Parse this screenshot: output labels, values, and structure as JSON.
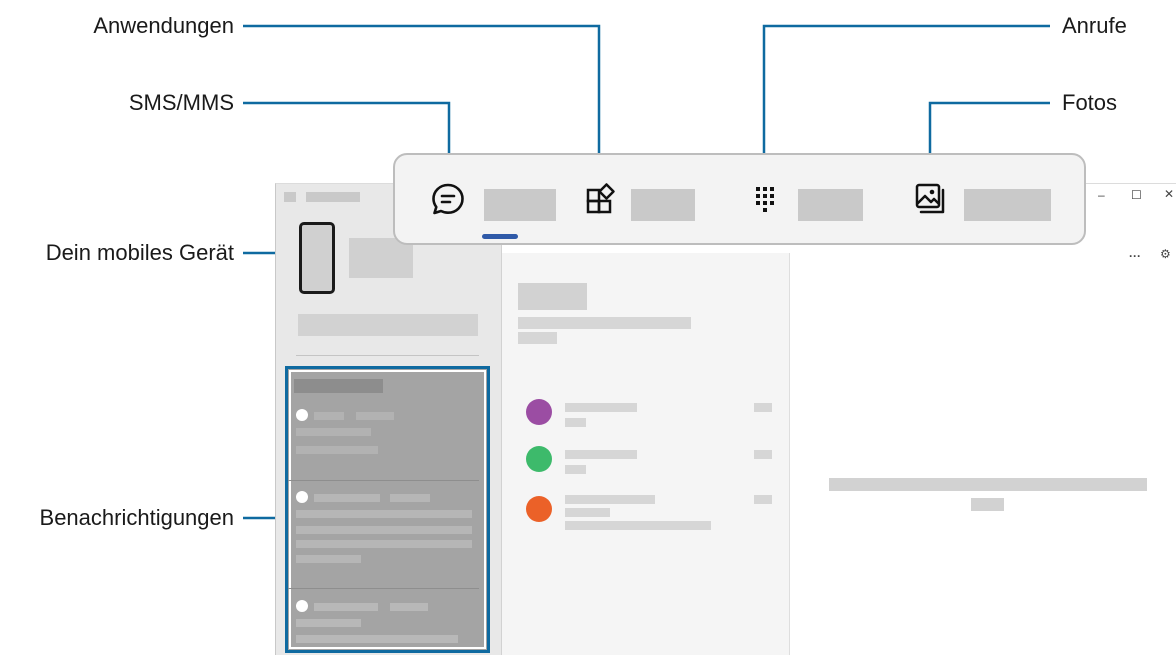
{
  "callouts": {
    "anwendungen": "Anwendungen",
    "sms_mms": "SMS/MMS",
    "device": "Dein mobiles Gerät",
    "notifications": "Benachrichtigungen",
    "calls": "Anrufe",
    "photos": "Fotos"
  },
  "window_controls": {
    "minimize": "–",
    "maximize": "☐",
    "close": "✕",
    "more": "···",
    "settings": "⚙"
  },
  "tabs": [
    {
      "icon": "message-bubble-icon",
      "active": true
    },
    {
      "icon": "apps-grid-icon",
      "active": false
    },
    {
      "icon": "dialpad-icon",
      "active": false
    },
    {
      "icon": "photos-gallery-icon",
      "active": false
    }
  ],
  "contacts": [
    {
      "avatar_color": "#9b4da3"
    },
    {
      "avatar_color": "#3dba6b"
    },
    {
      "avatar_color": "#eb6128"
    }
  ],
  "colors": {
    "callout_line": "#0f6aa0",
    "tab_indicator": "#2f5aa8"
  }
}
